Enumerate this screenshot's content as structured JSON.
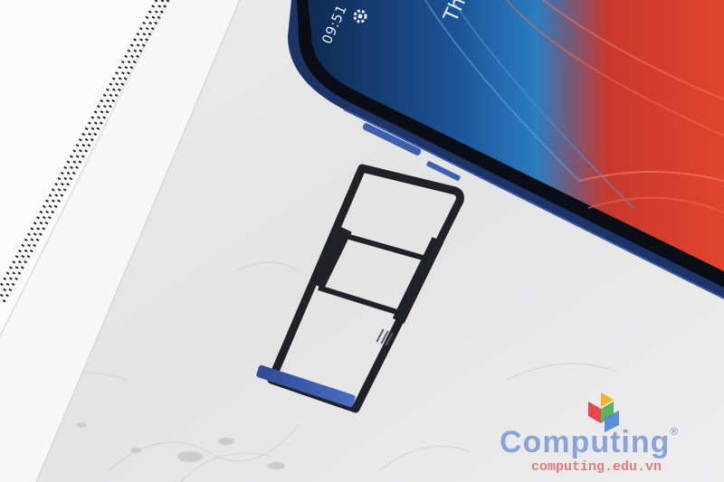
{
  "photo": {
    "phone_status": {
      "time": "09:51",
      "partial_header": "Th"
    },
    "watermark": {
      "brand": "Computing",
      "registered_mark": "®",
      "url": "computing.edu.vn",
      "logo_colors": [
        "#e8484b",
        "#f2b52c",
        "#5bb55a",
        "#4b86d6"
      ]
    },
    "colors": {
      "background_marble": "#e9e9ea",
      "phone_frame": "#27447f",
      "screen_red": "#d83a2f",
      "screen_blue": "#1c4f8c",
      "sim_tray": "#1f2228",
      "sim_tray_edge": "#3b5aa6"
    }
  }
}
